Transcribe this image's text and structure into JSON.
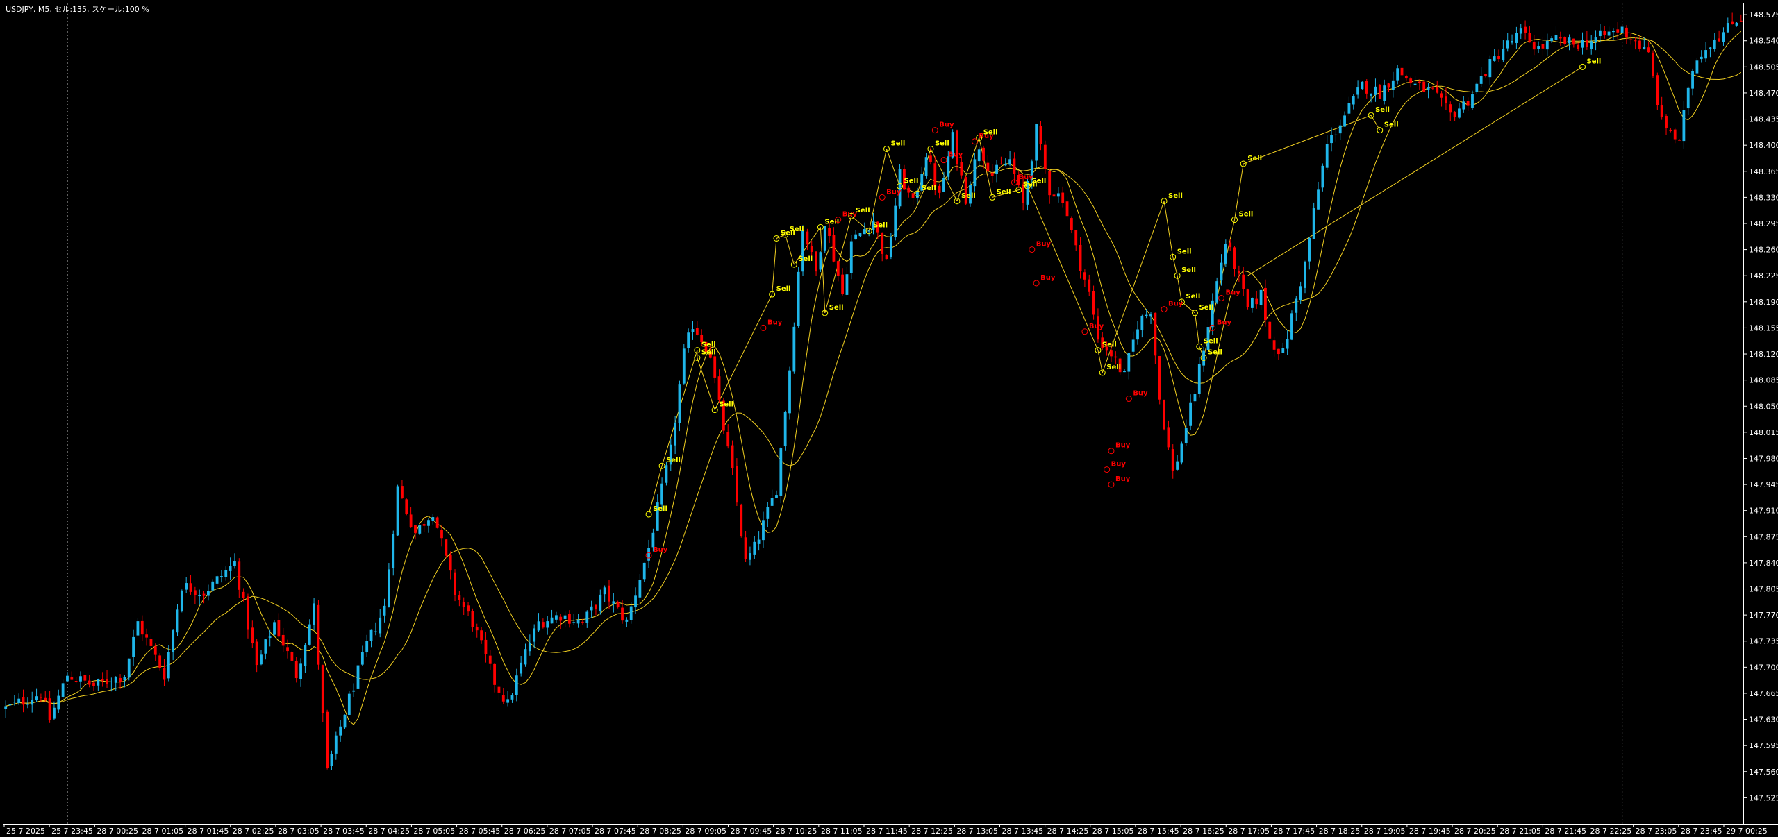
{
  "window": {
    "title": "USDJPY, M5, セル:135, スケール:100 %"
  },
  "colors": {
    "background": "#000000",
    "frame": "#ffffff",
    "bull_candle": "#1fb6ea",
    "bear_candle": "#ff0000",
    "ma_line": "#f2d021",
    "sell_label": "#ffff00",
    "buy_label": "#ff0000",
    "separator": "#ffffff"
  },
  "chart_data": {
    "type": "candlestick",
    "symbol": "USDJPY",
    "timeframe": "M5",
    "ylim": [
      147.49,
      148.59
    ],
    "grid": false,
    "y_ticks": [
      "148.575",
      "148.540",
      "148.505",
      "148.470",
      "148.435",
      "148.400",
      "148.365",
      "148.330",
      "148.295",
      "148.260",
      "148.225",
      "148.190",
      "148.155",
      "148.120",
      "148.085",
      "148.050",
      "148.015",
      "147.980",
      "147.945",
      "147.910",
      "147.875",
      "147.840",
      "147.805",
      "147.770",
      "147.735",
      "147.700",
      "147.665",
      "147.630",
      "147.595",
      "147.560",
      "147.525"
    ],
    "x_ticks": [
      "25 7 2025",
      "25 7 23:45",
      "28 7 00:25",
      "28 7 01:05",
      "28 7 01:45",
      "28 7 02:25",
      "28 7 03:05",
      "28 7 03:45",
      "28 7 04:25",
      "28 7 05:05",
      "28 7 05:45",
      "28 7 06:25",
      "28 7 07:05",
      "28 7 07:45",
      "28 7 08:25",
      "28 7 09:05",
      "28 7 09:45",
      "28 7 10:25",
      "28 7 11:05",
      "28 7 11:45",
      "28 7 12:25",
      "28 7 13:05",
      "28 7 13:45",
      "28 7 14:25",
      "28 7 15:05",
      "28 7 15:45",
      "28 7 16:25",
      "28 7 17:05",
      "28 7 17:45",
      "28 7 18:25",
      "28 7 19:05",
      "28 7 19:45",
      "28 7 20:25",
      "28 7 21:05",
      "28 7 21:45",
      "28 7 22:25",
      "28 7 23:05",
      "28 7 23:45",
      "29 7 00:25"
    ],
    "close_path": [
      [
        0,
        147.645
      ],
      [
        8,
        147.665
      ],
      [
        10,
        147.63
      ],
      [
        14,
        147.69
      ],
      [
        20,
        147.675
      ],
      [
        27,
        147.69
      ],
      [
        30,
        147.76
      ],
      [
        36,
        147.69
      ],
      [
        40,
        147.81
      ],
      [
        45,
        147.8
      ],
      [
        52,
        147.84
      ],
      [
        57,
        147.7
      ],
      [
        61,
        147.76
      ],
      [
        66,
        147.69
      ],
      [
        70,
        147.78
      ],
      [
        73,
        147.56
      ],
      [
        77,
        147.64
      ],
      [
        82,
        147.73
      ],
      [
        86,
        147.78
      ],
      [
        89,
        147.94
      ],
      [
        93,
        147.88
      ],
      [
        97,
        147.91
      ],
      [
        102,
        147.8
      ],
      [
        106,
        147.76
      ],
      [
        111,
        147.68
      ],
      [
        114,
        147.65
      ],
      [
        118,
        147.72
      ],
      [
        121,
        147.76
      ],
      [
        126,
        147.77
      ],
      [
        131,
        147.76
      ],
      [
        136,
        147.8
      ],
      [
        141,
        147.76
      ],
      [
        146,
        147.86
      ],
      [
        151,
        147.99
      ],
      [
        154,
        148.12
      ],
      [
        156,
        148.16
      ],
      [
        160,
        148.12
      ],
      [
        162,
        148.05
      ],
      [
        165,
        147.96
      ],
      [
        168,
        147.84
      ],
      [
        170,
        147.86
      ],
      [
        175,
        147.94
      ],
      [
        178,
        148.1
      ],
      [
        180,
        148.23
      ],
      [
        181,
        148.29
      ],
      [
        184,
        148.23
      ],
      [
        186,
        148.3
      ],
      [
        190,
        148.2
      ],
      [
        192,
        148.27
      ],
      [
        197,
        148.3
      ],
      [
        200,
        148.24
      ],
      [
        203,
        148.36
      ],
      [
        206,
        148.32
      ],
      [
        209,
        148.39
      ],
      [
        212,
        148.33
      ],
      [
        215,
        148.41
      ],
      [
        218,
        148.33
      ],
      [
        221,
        148.4
      ],
      [
        224,
        148.36
      ],
      [
        228,
        148.38
      ],
      [
        231,
        148.32
      ],
      [
        234,
        148.42
      ],
      [
        237,
        148.34
      ],
      [
        240,
        148.33
      ],
      [
        243,
        148.26
      ],
      [
        246,
        148.2
      ],
      [
        248,
        148.14
      ],
      [
        251,
        148.12
      ],
      [
        254,
        148.09
      ],
      [
        257,
        148.16
      ],
      [
        260,
        148.18
      ],
      [
        262,
        148.06
      ],
      [
        265,
        147.96
      ],
      [
        267,
        148.0
      ],
      [
        270,
        148.07
      ],
      [
        272,
        148.13
      ],
      [
        274,
        148.19
      ],
      [
        277,
        148.27
      ],
      [
        279,
        148.24
      ],
      [
        282,
        148.18
      ],
      [
        285,
        148.2
      ],
      [
        287,
        148.14
      ],
      [
        290,
        148.12
      ],
      [
        292,
        148.17
      ],
      [
        295,
        148.24
      ],
      [
        297,
        148.31
      ],
      [
        300,
        148.4
      ],
      [
        304,
        148.44
      ],
      [
        308,
        148.48
      ],
      [
        312,
        148.47
      ],
      [
        316,
        148.5
      ],
      [
        320,
        148.48
      ],
      [
        324,
        148.47
      ],
      [
        328,
        148.44
      ],
      [
        332,
        148.46
      ],
      [
        336,
        148.5
      ],
      [
        340,
        148.53
      ],
      [
        344,
        148.55
      ],
      [
        348,
        148.53
      ],
      [
        352,
        148.54
      ],
      [
        356,
        148.535
      ],
      [
        360,
        148.54
      ],
      [
        364,
        148.55
      ],
      [
        367,
        148.555
      ],
      [
        370,
        148.54
      ],
      [
        373,
        148.52
      ],
      [
        376,
        148.43
      ],
      [
        378,
        148.42
      ],
      [
        380,
        148.4
      ],
      [
        382,
        148.48
      ],
      [
        384,
        148.52
      ],
      [
        386,
        148.53
      ],
      [
        388,
        148.545
      ],
      [
        390,
        148.55
      ],
      [
        393,
        148.57
      ]
    ],
    "series": [
      {
        "type": "moving-average",
        "length": 8
      },
      {
        "type": "moving-average",
        "length": 20
      }
    ],
    "annotations": [
      {
        "i": 146,
        "price": 147.905,
        "label": "Sell"
      },
      {
        "i": 149,
        "price": 147.97,
        "label": "Sell"
      },
      {
        "i": 157,
        "price": 148.125,
        "label": "Sell"
      },
      {
        "i": 157,
        "price": 148.115,
        "label": "Sell"
      },
      {
        "i": 161,
        "price": 148.045,
        "label": "Sell"
      },
      {
        "i": 146,
        "price": 147.85,
        "label": "Buy"
      },
      {
        "i": 174,
        "price": 148.2,
        "label": "Sell"
      },
      {
        "i": 175,
        "price": 148.275,
        "label": "Sell"
      },
      {
        "i": 177,
        "price": 148.28,
        "label": "Sell"
      },
      {
        "i": 179,
        "price": 148.24,
        "label": "Sell"
      },
      {
        "i": 172,
        "price": 148.155,
        "label": "Buy"
      },
      {
        "i": 185,
        "price": 148.29,
        "label": "Sell"
      },
      {
        "i": 186,
        "price": 148.175,
        "label": "Sell"
      },
      {
        "i": 189,
        "price": 148.3,
        "label": "Buy"
      },
      {
        "i": 192,
        "price": 148.305,
        "label": "Sell"
      },
      {
        "i": 196,
        "price": 148.285,
        "label": "Sell"
      },
      {
        "i": 199,
        "price": 148.33,
        "label": "Buy"
      },
      {
        "i": 200,
        "price": 148.395,
        "label": "Sell"
      },
      {
        "i": 203,
        "price": 148.345,
        "label": "Sell"
      },
      {
        "i": 207,
        "price": 148.335,
        "label": "Sell"
      },
      {
        "i": 210,
        "price": 148.395,
        "label": "Sell"
      },
      {
        "i": 211,
        "price": 148.42,
        "label": "Buy"
      },
      {
        "i": 213,
        "price": 148.38,
        "label": "Buy"
      },
      {
        "i": 216,
        "price": 148.325,
        "label": "Sell"
      },
      {
        "i": 220,
        "price": 148.405,
        "label": "Buy"
      },
      {
        "i": 221,
        "price": 148.41,
        "label": "Sell"
      },
      {
        "i": 224,
        "price": 148.33,
        "label": "Sell"
      },
      {
        "i": 229,
        "price": 148.35,
        "label": "Buy"
      },
      {
        "i": 230,
        "price": 148.34,
        "label": "Sell"
      },
      {
        "i": 232,
        "price": 148.345,
        "label": "Sell"
      },
      {
        "i": 233,
        "price": 148.26,
        "label": "Buy"
      },
      {
        "i": 234,
        "price": 148.215,
        "label": "Buy"
      },
      {
        "i": 245,
        "price": 148.15,
        "label": "Buy"
      },
      {
        "i": 248,
        "price": 148.125,
        "label": "Sell"
      },
      {
        "i": 249,
        "price": 148.095,
        "label": "Sell"
      },
      {
        "i": 250,
        "price": 147.965,
        "label": "Buy"
      },
      {
        "i": 251,
        "price": 147.99,
        "label": "Buy"
      },
      {
        "i": 251,
        "price": 147.945,
        "label": "Buy"
      },
      {
        "i": 255,
        "price": 148.06,
        "label": "Buy"
      },
      {
        "i": 263,
        "price": 148.325,
        "label": "Sell"
      },
      {
        "i": 265,
        "price": 148.25,
        "label": "Sell"
      },
      {
        "i": 266,
        "price": 148.225,
        "label": "Sell"
      },
      {
        "i": 267,
        "price": 148.19,
        "label": "Sell"
      },
      {
        "i": 263,
        "price": 148.18,
        "label": "Buy"
      },
      {
        "i": 270,
        "price": 148.175,
        "label": "Sell"
      },
      {
        "i": 271,
        "price": 148.13,
        "label": "Sell"
      },
      {
        "i": 272,
        "price": 148.115,
        "label": "Sell"
      },
      {
        "i": 274,
        "price": 148.155,
        "label": "Buy"
      },
      {
        "i": 276,
        "price": 148.195,
        "label": "Buy"
      },
      {
        "i": 279,
        "price": 148.3,
        "label": "Sell"
      },
      {
        "i": 281,
        "price": 148.375,
        "label": "Sell"
      },
      {
        "i": 310,
        "price": 148.44,
        "label": "Sell"
      },
      {
        "i": 312,
        "price": 148.42,
        "label": "Sell"
      },
      {
        "i": 358,
        "price": 148.505,
        "label": "Sell"
      }
    ]
  }
}
